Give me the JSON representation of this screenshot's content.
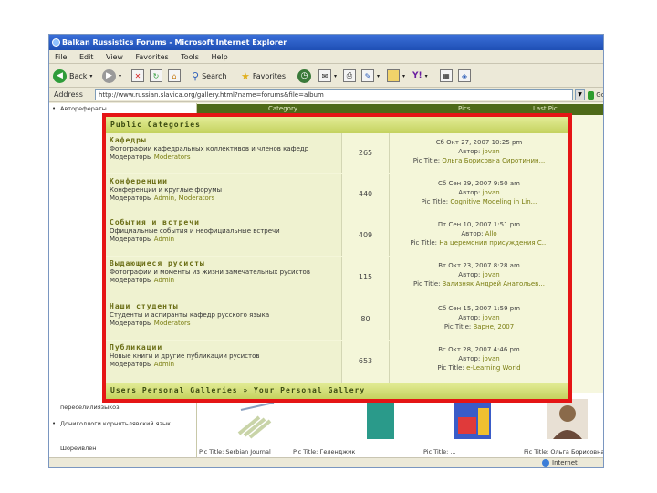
{
  "window": {
    "title": "Balkan Russistics Forums - Microsoft Internet Explorer"
  },
  "menu": [
    "File",
    "Edit",
    "View",
    "Favorites",
    "Tools",
    "Help"
  ],
  "toolbar": {
    "back": "Back",
    "search": "Search",
    "favorites": "Favorites"
  },
  "address": {
    "label": "Address",
    "url": "http://www.russian.slavica.org/gallery.html?name=forums&file=album",
    "go": "Go"
  },
  "left_col": [
    {
      "text": "Авторефераты"
    },
    {
      "text": "переселилиязыкоз"
    },
    {
      "text": "Дониголлоги корнятьлявский язык"
    },
    {
      "text": "Шорейвлен"
    }
  ],
  "table_header": {
    "category": "Category",
    "pics": "Pics",
    "last_pic": "Last Pic"
  },
  "categories_header": "Public Categories",
  "categories": [
    {
      "title": "Кафедры",
      "desc": "Фотографии кафедральных коллективов и членов кафедр",
      "mod_label": "Модераторы",
      "mod": "Moderators",
      "count": "265",
      "date": "Сб Окт 27, 2007 10:25 pm",
      "author_label": "Автор:",
      "author": "jovan",
      "pic_label": "Pic Title:",
      "pic": "Ольга Борисовна Сиротинин..."
    },
    {
      "title": "Конференции",
      "desc": "Конференции и круглые форумы",
      "mod_label": "Модераторы",
      "mod": "Admin, Moderators",
      "count": "440",
      "date": "Сб Сен 29, 2007 9:50 am",
      "author_label": "Автор:",
      "author": "jovan",
      "pic_label": "Pic Title:",
      "pic": "Cognitive Modeling in Lin..."
    },
    {
      "title": "События и встречи",
      "desc": "Официальные события и неофициальные встречи",
      "mod_label": "Модераторы",
      "mod": "Admin",
      "count": "409",
      "date": "Пт Сен 10, 2007 1:51 pm",
      "author_label": "Автор:",
      "author": "Allo",
      "pic_label": "Pic Title:",
      "pic": "На церемонии присуждения С..."
    },
    {
      "title": "Выдающиеся русисты",
      "desc": "Фотографии и моменты из жизни замечательных русистов",
      "mod_label": "Модераторы",
      "mod": "Admin",
      "count": "115",
      "date": "Вт Окт 23, 2007 8:28 am",
      "author_label": "Автор:",
      "author": "jovan",
      "pic_label": "Pic Title:",
      "pic": "Зализняк Андрей Анатольев..."
    },
    {
      "title": "Наши студенты",
      "desc": "Студенты и аспиранты кафедр русского языка",
      "mod_label": "Модераторы",
      "mod": "Moderators",
      "count": "80",
      "date": "Сб Сен 15, 2007 1:59 pm",
      "author_label": "Автор:",
      "author": "jovan",
      "pic_label": "Pic Title:",
      "pic": "Варне, 2007"
    },
    {
      "title": "Публикации",
      "desc": "Новые книги и другие публикации русистов",
      "mod_label": "Модераторы",
      "mod": "Admin",
      "count": "653",
      "date": "Вс Окт 28, 2007 4:46 pm",
      "author_label": "Автор:",
      "author": "jovan",
      "pic_label": "Pic Title:",
      "pic": "e-Learning World"
    }
  ],
  "footer": "Users Personal Galleries » Your Personal Gallery",
  "thumbs": [
    {
      "caption": "Pic Title: Serbian Journal",
      "color": "#c9d4a8"
    },
    {
      "caption": "Pic Title: Геленджик",
      "color": "#2a9a8a"
    },
    {
      "caption": "Pic Title: ...",
      "color": "#3a5cc8"
    },
    {
      "caption": "Pic Title: Ольга Борисовна",
      "color": "#8a6a4a"
    }
  ],
  "status": {
    "zone": "Internet"
  },
  "colors": {
    "highlight_border": "#e51515",
    "panel_bg": "#f4f6d9",
    "header_bar": "#c4d25e",
    "link": "#7a7d10"
  }
}
